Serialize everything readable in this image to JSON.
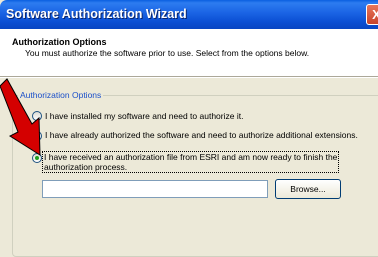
{
  "window": {
    "title": "Software Authorization Wizard",
    "close_label": "X"
  },
  "header": {
    "title": "Authorization Options",
    "subtitle": "You must authorize the software prior to use. Select from the options below."
  },
  "group": {
    "legend": "Authorization Options",
    "options": [
      {
        "label": "I have installed my software and need to authorize it.",
        "checked": false
      },
      {
        "label": "I have already authorized the software and need to authorize additional extensions.",
        "checked": false
      },
      {
        "label_line1": "I have received an authorization file from ESRI and am now ready to finish the",
        "label_line2": "authorization process.",
        "checked": true
      }
    ],
    "file_input_value": "",
    "browse_label": "Browse..."
  },
  "colors": {
    "arrow": "#d40000",
    "titlebar": "#0a5fe0",
    "legend": "#1a4fc9"
  }
}
